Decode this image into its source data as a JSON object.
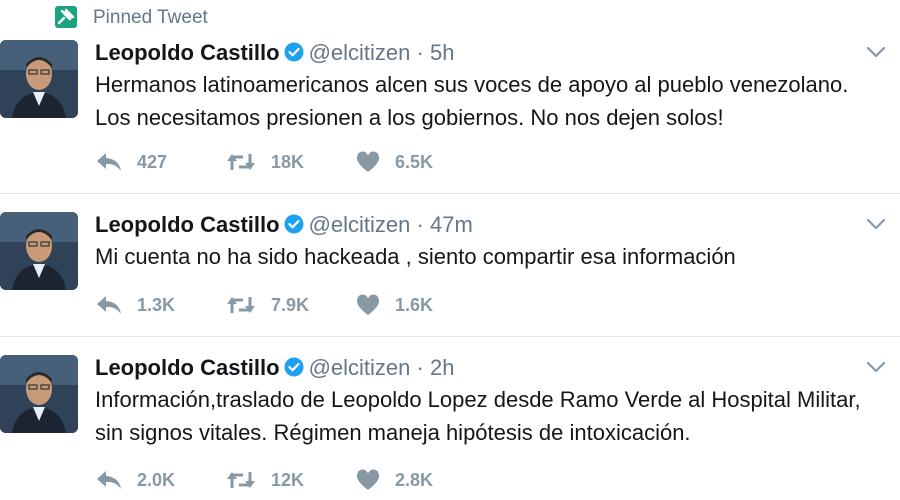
{
  "pinned": {
    "label": "Pinned Tweet",
    "icon": "pin-icon"
  },
  "colors": {
    "pinned": "#19a37f",
    "verified": "#1da1f2",
    "text": "#14171a",
    "muted": "#657786",
    "action": "#8899a6"
  },
  "tweets": [
    {
      "name": "Leopoldo Castillo",
      "handle": "@elcitizen",
      "separator": "·",
      "time": "5h",
      "lines": [
        "Hermanos latinoamericanos alcen sus voces de apoyo al pueblo venezolano.",
        "Los necesitamos presionen a los gobiernos. No nos dejen solos!"
      ],
      "replies": "427",
      "retweets": "18K",
      "likes": "6.5K"
    },
    {
      "name": "Leopoldo Castillo",
      "handle": "@elcitizen",
      "separator": "·",
      "time": "47m",
      "lines": [
        "Mi cuenta no ha sido hackeada , siento compartir esa información"
      ],
      "replies": "1.3K",
      "retweets": "7.9K",
      "likes": "1.6K"
    },
    {
      "name": "Leopoldo Castillo",
      "handle": "@elcitizen",
      "separator": "·",
      "time": "2h",
      "lines": [
        "Información,traslado de Leopoldo Lopez desde Ramo Verde al Hospital Militar,",
        "sin signos vitales. Régimen maneja hipótesis de intoxicación."
      ],
      "replies": "2.0K",
      "retweets": "12K",
      "likes": "2.8K"
    }
  ]
}
